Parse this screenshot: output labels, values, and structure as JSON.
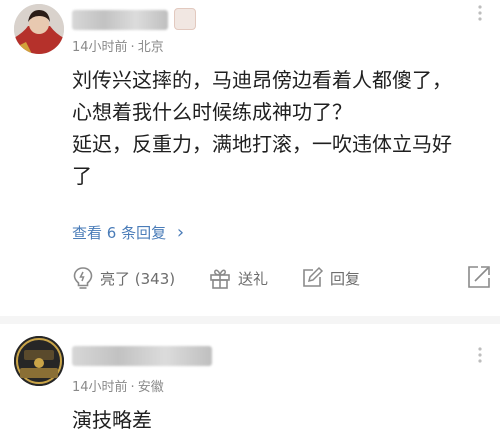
{
  "comments": [
    {
      "meta": {
        "time": "14小时前",
        "separator": "·",
        "location": "北京"
      },
      "lines": [
        "刘传兴这摔的，马迪昂傍边看着人都傻了，",
        "心想着我什么时候练成神功了？",
        "延迟，反重力，满地打滚，一吹违体立马好",
        "了"
      ],
      "view_replies": "查看 6 条回复",
      "view_replies_arrow": "›",
      "actions": {
        "like": "亮了 (343)",
        "gift": "送礼",
        "reply": "回复"
      }
    },
    {
      "meta": {
        "time": "14小时前",
        "separator": "·",
        "location": "安徽"
      },
      "lines": [
        "演技略差"
      ]
    }
  ],
  "icons": {
    "like": "lightbulb-icon",
    "gift": "gift-icon",
    "reply": "edit-icon",
    "share": "share-icon",
    "more": "more-icon"
  },
  "colors": {
    "link": "#4a7cb8",
    "meta": "#8a8a8a",
    "action": "#6d6d6d"
  }
}
